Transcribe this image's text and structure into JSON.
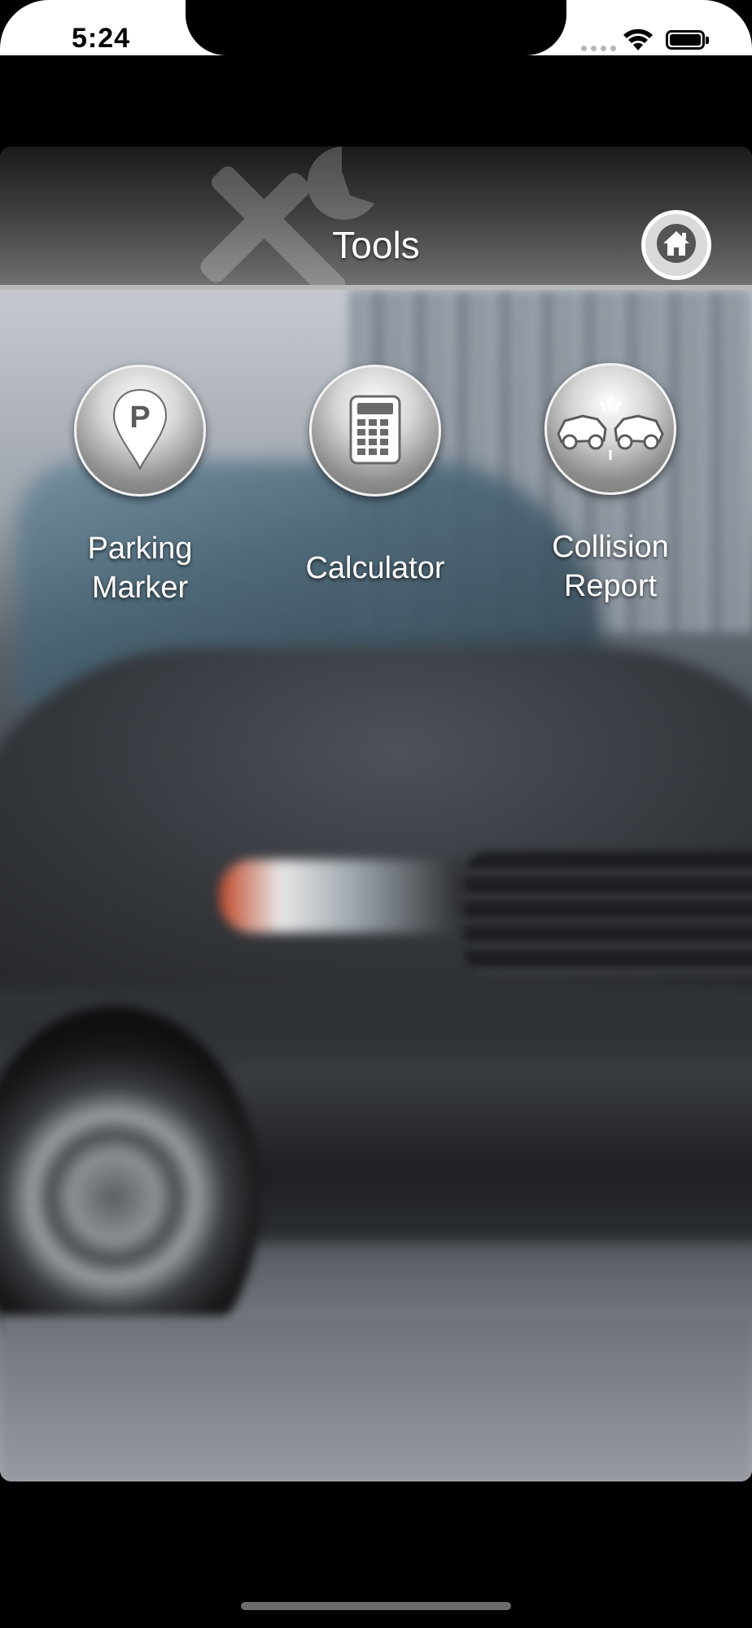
{
  "status_bar": {
    "time": "5:24"
  },
  "header": {
    "title": "Tools",
    "home_icon": "home-icon",
    "background_icon": "wrench-screwdriver-icon"
  },
  "tools": [
    {
      "label_line1": "Parking",
      "label_line2": "Marker",
      "icon": "parking-marker-icon"
    },
    {
      "label_line1": "Calculator",
      "label_line2": "",
      "icon": "calculator-icon"
    },
    {
      "label_line1": "Collision",
      "label_line2": "Report",
      "icon": "collision-icon"
    }
  ],
  "colors": {
    "header_dark": "#1a1a1a",
    "header_light": "#6f6f6f",
    "label_text": "#ffffff"
  }
}
